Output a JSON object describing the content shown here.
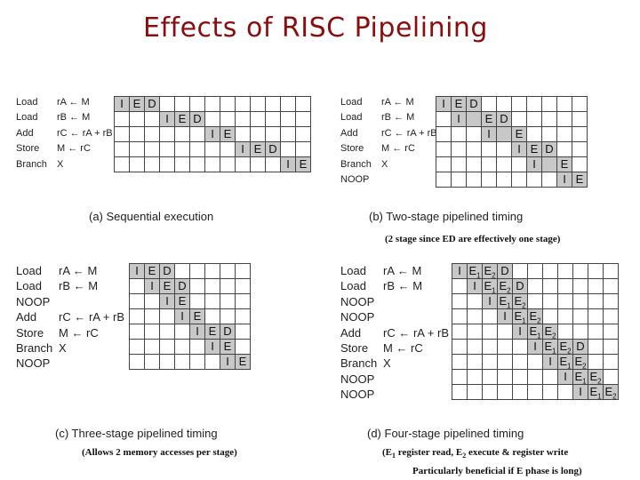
{
  "title": "Effects of RISC Pipelining",
  "diagrams": {
    "a": {
      "caption": "(a) Sequential execution",
      "columns": 13,
      "instructions": [
        {
          "op": "Load",
          "arg": "rA ← M"
        },
        {
          "op": "Load",
          "arg": "rB ← M"
        },
        {
          "op": "Add",
          "arg": "rC ← rA + rB"
        },
        {
          "op": "Store",
          "arg": "M ← rC"
        },
        {
          "op": "Branch",
          "arg": "X"
        }
      ],
      "rows": [
        {
          "start": 0,
          "stages": [
            "I",
            "E",
            "D"
          ]
        },
        {
          "start": 3,
          "stages": [
            "I",
            "E",
            "D"
          ]
        },
        {
          "start": 6,
          "stages": [
            "I",
            "E"
          ]
        },
        {
          "start": 8,
          "stages": [
            "I",
            "E",
            "D"
          ]
        },
        {
          "start": 11,
          "stages": [
            "I",
            "E"
          ]
        }
      ]
    },
    "b": {
      "caption": "(b) Two-stage pipelined timing",
      "note": "(2 stage since ED are effectively one stage)",
      "columns": 10,
      "instructions": [
        {
          "op": "Load",
          "arg": "rA ← M"
        },
        {
          "op": "Load",
          "arg": "rB ← M"
        },
        {
          "op": "Add",
          "arg": "rC ← rA + rB"
        },
        {
          "op": "Store",
          "arg": "M ← rC"
        },
        {
          "op": "Branch",
          "arg": "X"
        },
        {
          "op": "NOOP",
          "arg": ""
        }
      ],
      "rows": [
        {
          "start": 0,
          "stages": [
            "I",
            "E",
            "D"
          ]
        },
        {
          "start": 1,
          "stages": [
            "I",
            "",
            "E",
            "D"
          ]
        },
        {
          "start": 3,
          "stages": [
            "I",
            "",
            "E"
          ]
        },
        {
          "start": 5,
          "stages": [
            "I",
            "E",
            "D"
          ]
        },
        {
          "start": 6,
          "stages": [
            "I",
            "",
            "E"
          ]
        },
        {
          "start": 8,
          "stages": [
            "I",
            "E"
          ]
        }
      ]
    },
    "c": {
      "caption": "(c) Three-stage pipelined timing",
      "note": "(Allows 2 memory accesses per stage)",
      "columns": 8,
      "instructions": [
        {
          "op": "Load",
          "arg": "rA ← M"
        },
        {
          "op": "Load",
          "arg": "rB ← M"
        },
        {
          "op": "NOOP",
          "arg": ""
        },
        {
          "op": "Add",
          "arg": "rC ← rA + rB"
        },
        {
          "op": "Store",
          "arg": "M ← rC"
        },
        {
          "op": "Branch",
          "arg": "X"
        },
        {
          "op": "NOOP",
          "arg": ""
        }
      ],
      "rows": [
        {
          "start": 0,
          "stages": [
            "I",
            "E",
            "D"
          ]
        },
        {
          "start": 1,
          "stages": [
            "I",
            "E",
            "D"
          ]
        },
        {
          "start": 2,
          "stages": [
            "I",
            "E"
          ]
        },
        {
          "start": 3,
          "stages": [
            "I",
            "E"
          ]
        },
        {
          "start": 4,
          "stages": [
            "I",
            "E",
            "D"
          ]
        },
        {
          "start": 5,
          "stages": [
            "I",
            "E"
          ]
        },
        {
          "start": 6,
          "stages": [
            "I",
            "E"
          ]
        }
      ]
    },
    "d": {
      "caption": "(d) Four-stage pipelined timing",
      "note_line1": "(E1 register read,  E2 execute & register write",
      "note_line2": "Particularly beneficial if E phase is long)",
      "columns": 11,
      "instructions": [
        {
          "op": "Load",
          "arg": "rA ← M"
        },
        {
          "op": "Load",
          "arg": "rB ← M"
        },
        {
          "op": "NOOP",
          "arg": ""
        },
        {
          "op": "NOOP",
          "arg": ""
        },
        {
          "op": "Add",
          "arg": "rC ← rA + rB"
        },
        {
          "op": "Store",
          "arg": "M ← rC"
        },
        {
          "op": "Branch",
          "arg": "X"
        },
        {
          "op": "NOOP",
          "arg": ""
        },
        {
          "op": "NOOP",
          "arg": ""
        }
      ],
      "rows": [
        {
          "start": 0,
          "stages": [
            "I",
            "E1",
            "E2",
            "D"
          ]
        },
        {
          "start": 1,
          "stages": [
            "I",
            "E1",
            "E2",
            "D"
          ]
        },
        {
          "start": 2,
          "stages": [
            "I",
            "E1",
            "E2"
          ]
        },
        {
          "start": 3,
          "stages": [
            "I",
            "E1",
            "E2"
          ]
        },
        {
          "start": 4,
          "stages": [
            "I",
            "E1",
            "E2"
          ]
        },
        {
          "start": 5,
          "stages": [
            "I",
            "E1",
            "E2",
            "D"
          ]
        },
        {
          "start": 6,
          "stages": [
            "I",
            "E1",
            "E2"
          ]
        },
        {
          "start": 7,
          "stages": [
            "I",
            "E1",
            "E2"
          ]
        },
        {
          "start": 8,
          "stages": [
            "I",
            "E1",
            "E2"
          ]
        }
      ]
    }
  }
}
